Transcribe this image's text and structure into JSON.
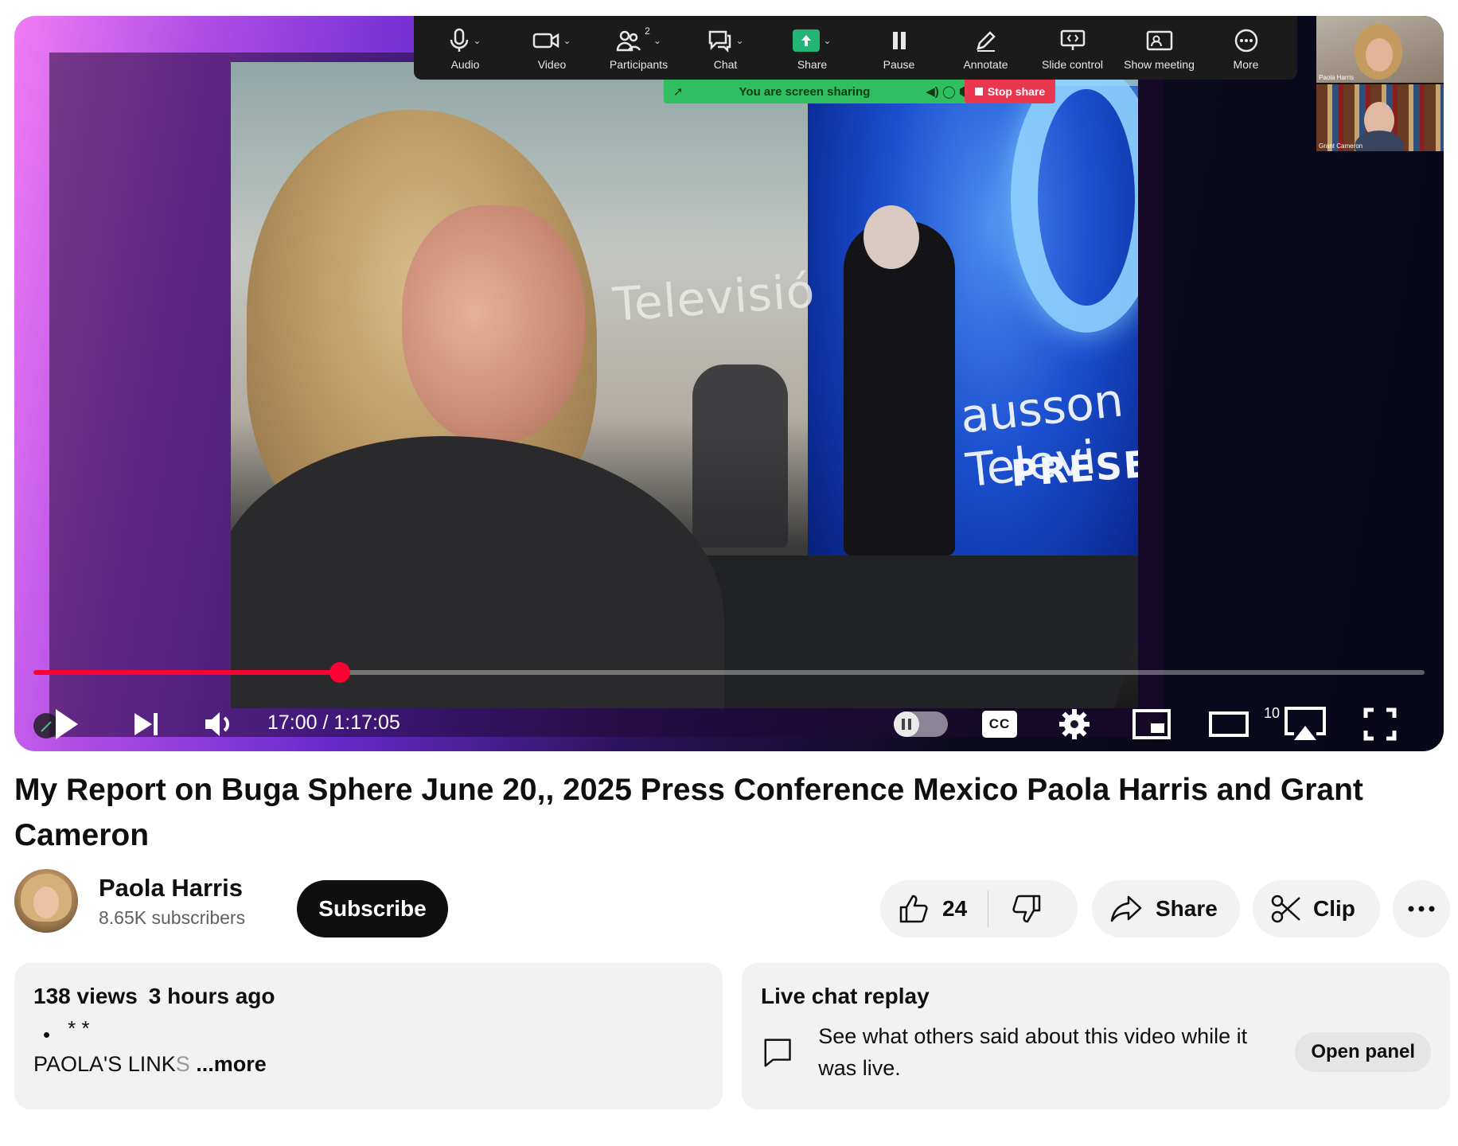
{
  "zoom_toolbar": {
    "items": [
      {
        "label": "Audio",
        "icon": "microphone-icon"
      },
      {
        "label": "Video",
        "icon": "video-camera-icon"
      },
      {
        "label": "Participants",
        "icon": "participants-icon",
        "count": "2"
      },
      {
        "label": "Chat",
        "icon": "chat-icon"
      },
      {
        "label": "Share",
        "icon": "share-screen-icon"
      },
      {
        "label": "Pause",
        "icon": "pause-icon"
      },
      {
        "label": "Annotate",
        "icon": "pencil-icon"
      },
      {
        "label": "Slide control",
        "icon": "slide-control-icon"
      },
      {
        "label": "Show meeting",
        "icon": "show-meeting-icon"
      },
      {
        "label": "More",
        "icon": "more-icon"
      }
    ],
    "sharing_banner": "You are screen sharing",
    "stop_share": "Stop share",
    "accent_green": "#2fbf61",
    "stop_red": "#e8374f",
    "participants": [
      {
        "name": "Paola Harris"
      },
      {
        "name": "Grant Cameron"
      }
    ]
  },
  "video_frame": {
    "sign_left": "Televisió",
    "sign_right": "ausson Televi",
    "sign_presenta": "PRESENTA"
  },
  "player": {
    "time_display": "17:00 / 1:17:05",
    "progress": 0.22,
    "progress_color": "#ff0033",
    "autoplay_on": false,
    "cc_label": "CC",
    "theater_badge": "10"
  },
  "video": {
    "title": "My Report on Buga Sphere June 20,, 2025 Press Conference Mexico Paola Harris and Grant Cameron"
  },
  "channel": {
    "name": "Paola Harris",
    "subscribers": "8.65K subscribers",
    "subscribe_label": "Subscribe"
  },
  "actions": {
    "like_count": "24",
    "share_label": "Share",
    "clip_label": "Clip"
  },
  "description": {
    "views": "138 views",
    "age": "3 hours ago",
    "bullet": "•",
    "stars": "* *",
    "links_text": "PAOLA'S LINK",
    "links_fade": "S",
    "more_label": "...more"
  },
  "live_chat": {
    "title": "Live chat replay",
    "text": "See what others said about this video while it was live.",
    "open_panel_label": "Open panel"
  }
}
